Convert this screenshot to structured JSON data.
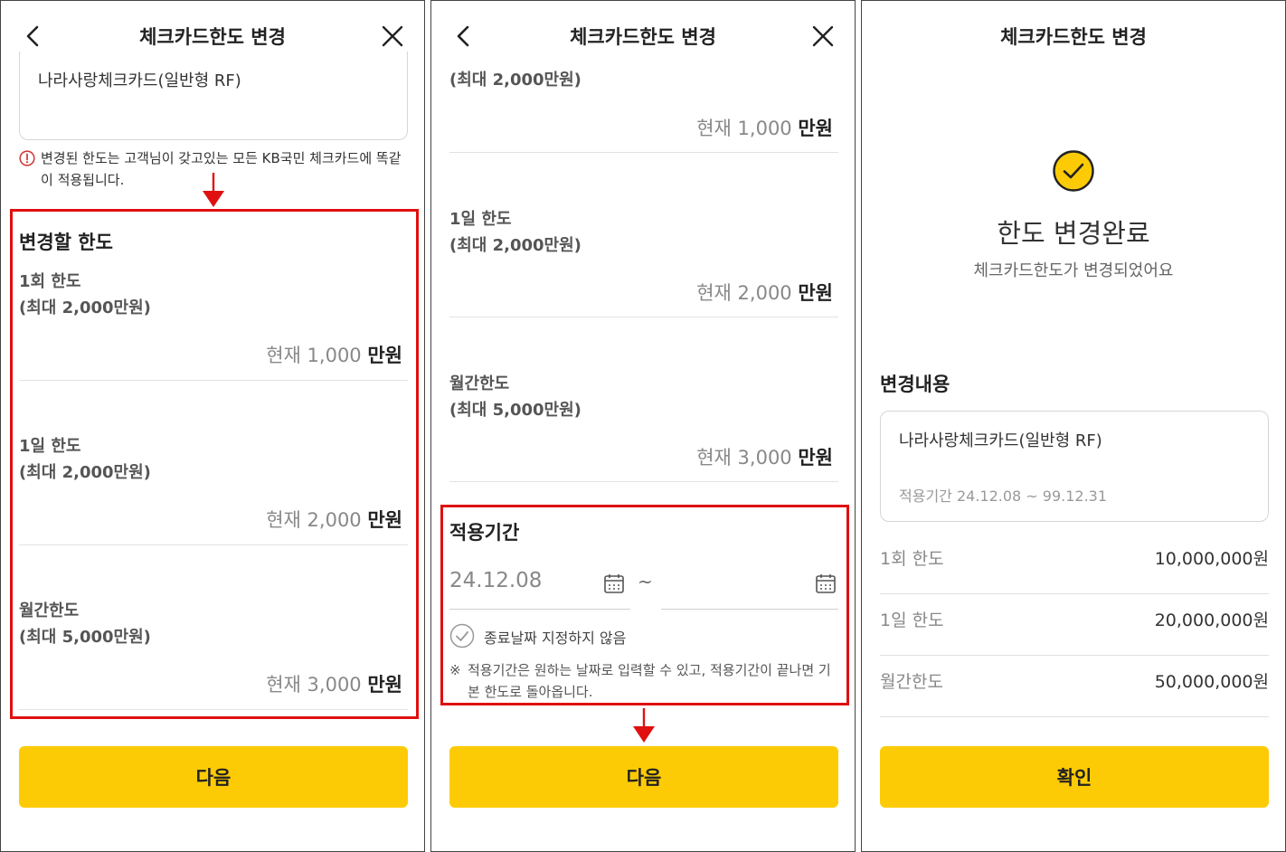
{
  "common": {
    "header_title": "체크카드한도 변경",
    "next_label": "다음",
    "confirm_label": "확인",
    "current_prefix": "현재",
    "unit": "만원"
  },
  "panel1": {
    "card_name": "나라사랑체크카드(일반형 RF)",
    "notice": "변경된 한도는 고객님이 갖고있는 모든 KB국민 체크카드에 똑같이 적용됩니다.",
    "section_title": "변경할 한도",
    "limits": [
      {
        "name": "1회 한도",
        "max": "(최대 2,000만원)",
        "current": "1,000"
      },
      {
        "name": "1일 한도",
        "max": "(최대 2,000만원)",
        "current": "2,000"
      },
      {
        "name": "월간한도",
        "max": "(최대 5,000만원)",
        "current": "3,000"
      }
    ]
  },
  "panel2": {
    "limits": [
      {
        "name": "",
        "max": "(최대 2,000만원)",
        "current": "1,000"
      },
      {
        "name": "1일 한도",
        "max": "(최대 2,000만원)",
        "current": "2,000"
      },
      {
        "name": "월간한도",
        "max": "(최대 5,000만원)",
        "current": "3,000"
      }
    ],
    "period_title": "적용기간",
    "start_date": "24.12.08",
    "tilde": "~",
    "end_date": "",
    "no_end_label": "종료날짜 지정하지 않음",
    "note_mark": "※",
    "note": "적용기간은 원하는 날짜로 입력할 수 있고, 적용기간이 끝나면 기본 한도로 돌아옵니다."
  },
  "panel3": {
    "done_title": "한도 변경완료",
    "done_sub": "체크카드한도가 변경되었어요",
    "detail_title": "변경내용",
    "card_name": "나라사랑체크카드(일반형 RF)",
    "period": "적용기간 24.12.08 ~ 99.12.31",
    "summary": [
      {
        "label": "1회 한도",
        "value": "10,000,000원"
      },
      {
        "label": "1일 한도",
        "value": "20,000,000원"
      },
      {
        "label": "월간한도",
        "value": "50,000,000원"
      }
    ]
  },
  "colors": {
    "accent_yellow": "#fdcb05",
    "highlight_red": "#e01010",
    "warning_red": "#d23c3c"
  }
}
